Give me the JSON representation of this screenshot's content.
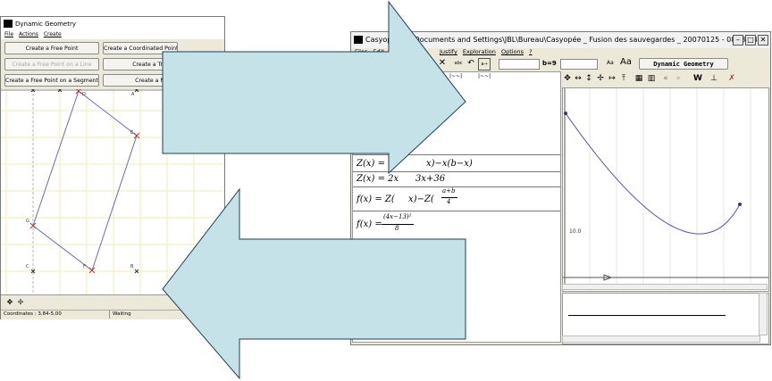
{
  "geo": {
    "title": "Dynamic Geometry",
    "menu": [
      "File",
      "Actions",
      "Create"
    ],
    "buttons": {
      "free_point": "Create a Free Point",
      "coordinated_point": "Create a Coordinated Point",
      "point_on_line": "Create a Free Point on a Line",
      "translated_point": "Create a Translated Po",
      "point_on_segment": "Create a Free Point on a Segment",
      "middle_point": "Create a Middle Poin"
    },
    "points": {
      "D": "D",
      "A": "A",
      "E": "E",
      "G": "G",
      "C": "C",
      "F": "F",
      "B": "B"
    },
    "status": {
      "coordinates": "Coordinates : 3.84-5.00",
      "state": "Waiting"
    }
  },
  "casy": {
    "title": "Casyopée ... \\Documents and Settings\\JBL\\Bureau\\Casyopée _ Fusion des sauvegardes _ 20070125 - 08H37\\B...",
    "menu": [
      "Files",
      "Edit",
      "Justify",
      "Exploration",
      "Options",
      "?"
    ],
    "toolbar": {
      "dyn_geo": "Dynamic Geometry",
      "b_label": "b=9",
      "aa_small": "Aa",
      "aa_big": "Aa",
      "tilde1": "|~~|",
      "tilde2": "|~~|"
    },
    "formulas": {
      "f1_left": "Z(x) = a",
      "f1_right": "x)−x(b−x)",
      "f2_left": "Z(x) = 2x",
      "f2_right": "3x+36",
      "f3_left": "f(x) = Z(",
      "f3_right": "x)−Z(",
      "f3_num": "a+b",
      "f3_den": "4",
      "f4_left": "f(x) =",
      "f4_num": "(4x−13)²",
      "f4_den": "8"
    },
    "graph_label": "10.0",
    "graph_icons": [
      "move-icon",
      "h-arrows-icon",
      "v-arrows-icon",
      "cross-arrows-icon",
      "h-fit-icon",
      "v-fit-icon",
      "grid-a-icon",
      "grid-b-icon",
      "back-icon",
      "forward-icon",
      "w-icon",
      "axes-icon",
      "clear-icon"
    ],
    "graph_icon_glyphs": [
      "✥",
      "↔",
      "↕",
      "✢",
      "↦",
      "⤒",
      "▦",
      "▥",
      "«",
      "»",
      "W",
      "⊥",
      "✗"
    ]
  },
  "colors": {
    "arrow_fill": "#c5e2e8",
    "arrow_stroke": "#1f3f55",
    "curve": "#5555c0",
    "grid": "#f1eeb4"
  }
}
